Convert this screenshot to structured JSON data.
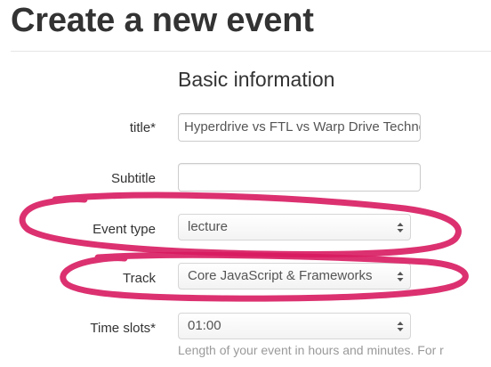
{
  "page": {
    "title": "Create a new event"
  },
  "form": {
    "section_heading": "Basic information",
    "fields": {
      "title": {
        "label": "title*",
        "value": "Hyperdrive vs FTL vs Warp Drive Technologies"
      },
      "subtitle": {
        "label": "Subtitle",
        "value": ""
      },
      "event_type": {
        "label": "Event type",
        "selected": "lecture"
      },
      "track": {
        "label": "Track",
        "selected": "Core JavaScript & Frameworks"
      },
      "time_slots": {
        "label": "Time slots*",
        "selected": "01:00",
        "help": "Length of your event in hours and minutes. For r"
      }
    }
  },
  "colors": {
    "annotation_ink": "#d81b60",
    "text": "#333333",
    "muted": "#9a9a9a",
    "border": "#cccccc"
  },
  "icons": {
    "select_arrows": "up-down-chevron-icon"
  }
}
